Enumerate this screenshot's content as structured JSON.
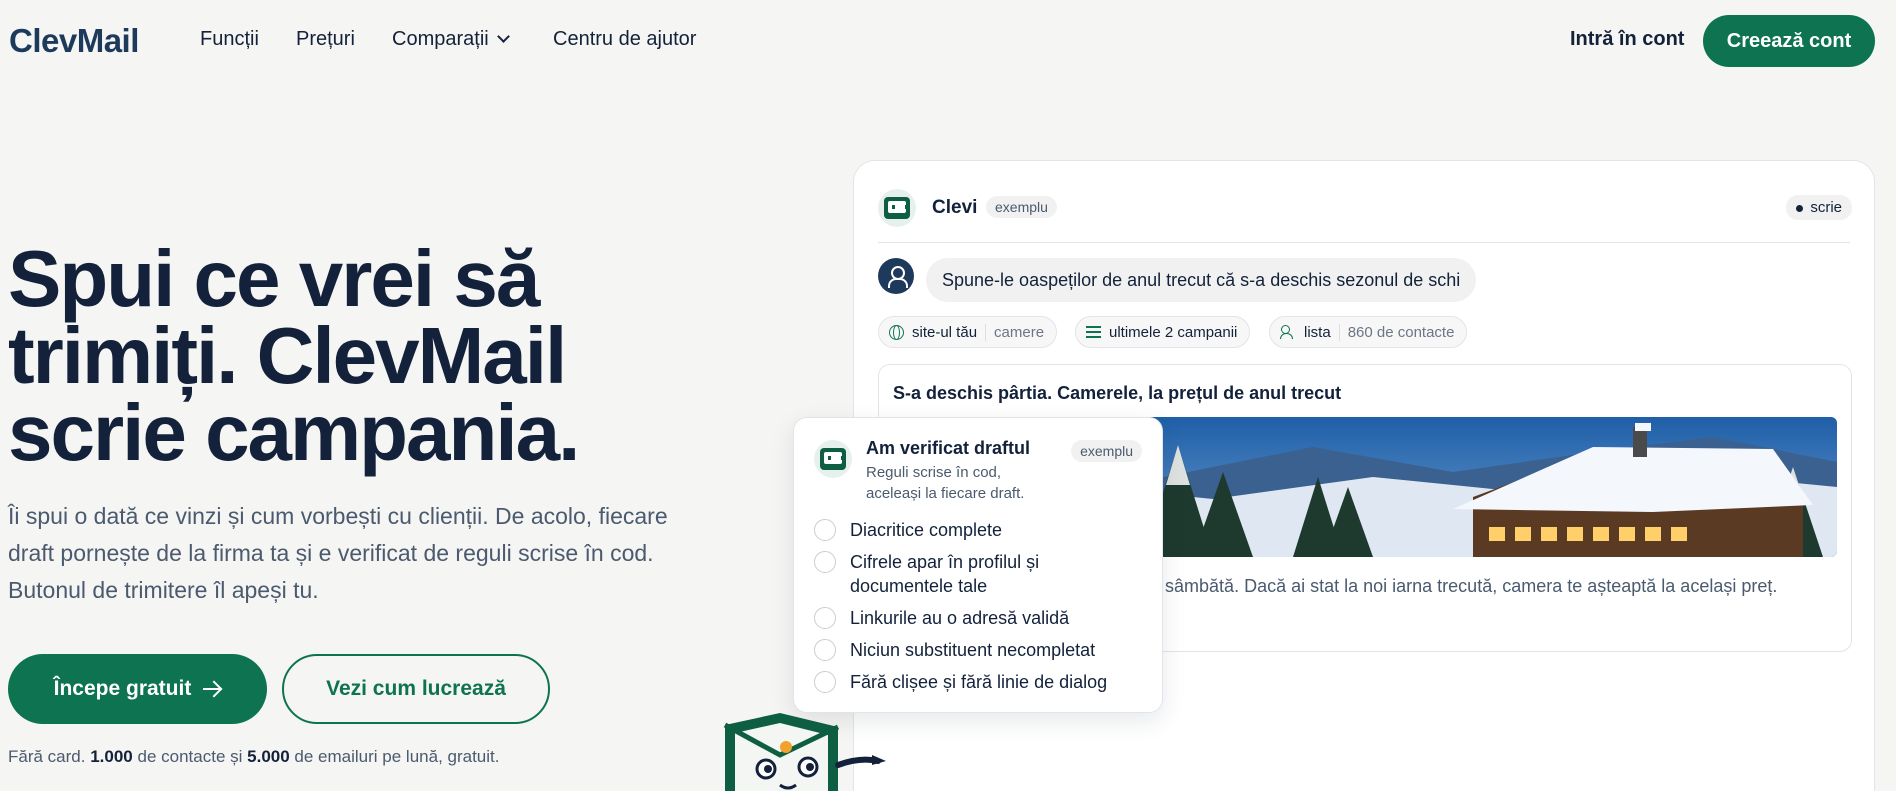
{
  "nav": {
    "logo": "ClevMail",
    "links": [
      "Funcții",
      "Prețuri",
      "Comparații",
      "Centru de ajutor"
    ],
    "login": "Intră în cont",
    "signup": "Creează cont"
  },
  "hero": {
    "title_lines": [
      "Spui ce vrei să",
      "trimiți. ClevMail",
      "scrie campania."
    ],
    "subtitle": "Îi spui o dată ce vinzi și cum vorbești cu clienții. De acolo, fiecare draft pornește de la firma ta și e verificat de reguli scrise în cod. Butonul de trimitere îl apeși tu.",
    "primary_cta": "Începe gratuit",
    "secondary_cta": "Vezi cum lucrează",
    "fine_pre": "Fără card.",
    "fine_contacts": "1.000",
    "fine_mid": "de contacte și",
    "fine_emails": "5.000",
    "fine_post": "de emailuri pe lună, gratuit."
  },
  "panel": {
    "name": "Clevi",
    "tag": "exemplu",
    "status": "scrie",
    "prompt": "Spune-le oaspeților de anul trecut că s-a deschis sezonul de schi",
    "chips": [
      {
        "label": "site-ul tău",
        "value": "camere",
        "icon": "globe-icon"
      },
      {
        "label": "ultimele 2 campanii",
        "value": "",
        "icon": "list-icon"
      },
      {
        "label": "lista",
        "value": "860 de contacte",
        "icon": "users-icon"
      }
    ],
    "email": {
      "subject": "S-a deschis pârtia. Camerele, la prețul de anul trecut",
      "body_visible": "ă de sâmbătă. Dacă ai stat la noi iarna trecută, camera te așteaptă la același preț."
    }
  },
  "checklist": {
    "title": "Am verificat draftul",
    "tag": "exemplu",
    "desc": "Reguli scrise în cod, aceleași la fiecare draft.",
    "items": [
      "Diacritice complete",
      "Cifrele apar în profilul și documentele tale",
      "Linkurile au o adresă validă",
      "Niciun substituent necompletat",
      "Fără clișee și fără linie de dialog"
    ]
  },
  "colors": {
    "accent": "#0d7350",
    "navy": "#13223a",
    "background": "#f5f5f3"
  }
}
